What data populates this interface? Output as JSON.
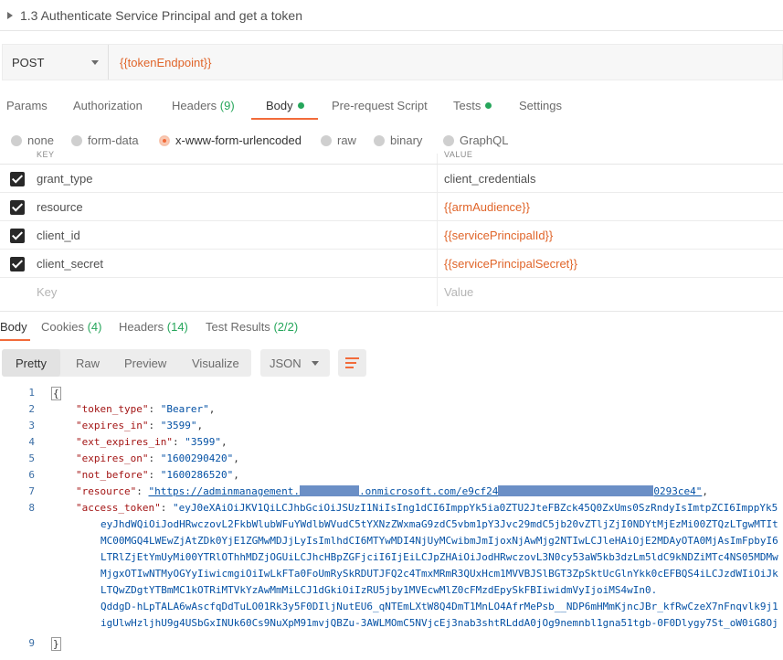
{
  "request": {
    "title": "1.3 Authenticate Service Principal and get a token",
    "method": "POST",
    "url": "{{tokenEndpoint}}"
  },
  "request_tabs": {
    "params": "Params",
    "authorization": "Authorization",
    "headers": "Headers",
    "headers_count": "(9)",
    "body": "Body",
    "prerequest": "Pre-request Script",
    "tests": "Tests",
    "settings": "Settings"
  },
  "body_modes": {
    "none": "none",
    "form_data": "form-data",
    "urlencoded": "x-www-form-urlencoded",
    "raw": "raw",
    "binary": "binary",
    "graphql": "GraphQL",
    "selected": "x-www-form-urlencoded"
  },
  "kv_table": {
    "key_header": "KEY",
    "value_header": "VALUE",
    "rows": [
      {
        "key": "grant_type",
        "value": "client_credentials",
        "checked": true
      },
      {
        "key": "resource",
        "value": "{{armAudience}}",
        "checked": true
      },
      {
        "key": "client_id",
        "value": "{{servicePrincipalId}}",
        "checked": true
      },
      {
        "key": "client_secret",
        "value": "{{servicePrincipalSecret}}",
        "checked": true
      }
    ],
    "key_placeholder": "Key",
    "value_placeholder": "Value"
  },
  "response_tabs": {
    "body": "Body",
    "cookies": "Cookies",
    "cookies_count": "(4)",
    "headers": "Headers",
    "headers_count": "(14)",
    "test_results": "Test Results",
    "test_results_count": "(2/2)"
  },
  "view_modes": {
    "pretty": "Pretty",
    "raw": "Raw",
    "preview": "Preview",
    "visualize": "Visualize",
    "format": "JSON"
  },
  "response_json": {
    "line_numbers": [
      "1",
      "2",
      "3",
      "4",
      "5",
      "6",
      "7",
      "8",
      "9"
    ],
    "open_brace": "{",
    "close_brace": "}",
    "token_type_key": "\"token_type\"",
    "token_type_val": "\"Bearer\"",
    "expires_in_key": "\"expires_in\"",
    "expires_in_val": "\"3599\"",
    "ext_expires_in_key": "\"ext_expires_in\"",
    "ext_expires_in_val": "\"3599\"",
    "expires_on_key": "\"expires_on\"",
    "expires_on_val": "\"1600290420\"",
    "not_before_key": "\"not_before\"",
    "not_before_val": "\"1600286520\"",
    "resource_key": "\"resource\"",
    "resource_val_a": "\"https://adminmanagement.",
    "resource_val_b": ".onmicrosoft.com/e9cf24",
    "resource_val_c": "0293ce4\"",
    "access_token_key": "\"access_token\"",
    "access_token_lines": [
      "\"eyJ0eXAiOiJKV1QiLCJhbGciOiJSUzI1NiIsIng1dCI6ImppYk5ia0ZTU2JteFBZck45Q0ZxUms0SzRndyIsImtpZCI6ImppYk5",
      "eyJhdWQiOiJodHRwczovL2FkbWlubWFuYWdlbWVudC5tYXNzZWxmaG9zdC5vbm1pY3Jvc29mdC5jb20vZTljZjI0NDYtMjEzMi00ZTQzLTgwMTIt",
      "MC00MGQ4LWEwZjAtZDk0YjE1ZGMwMDJjLyIsImlhdCI6MTYwMDI4NjUyMCwibmJmIjoxNjAwMjg2NTIwLCJleHAiOjE2MDAyOTA0MjAsImFpbyI6",
      "LTRlZjEtYmUyMi00YTRlOThhMDZjOGUiLCJhcHBpZGFjciI6IjEiLCJpZHAiOiJodHRwczovL3N0cy53aW5kb3dzLm5ldC9kNDZiMTc4NS05MDMw",
      "MjgxOTIwNTMyOGYyIiwicmgiOiIwLkFTa0FoUmRySkRDUTJFQ2c4TmxMRmR3QUxHcm1MVVBJSlBGT3ZpSktUcGlnYkk0cEFBQS4iLCJzdWIiOiJk",
      "LTQwZDgtYTBmMC1kOTRiMTVkYzAwMmMiLCJ1dGkiOiIzRU5jby1MVEcwMlZ0cFMzdEpySkFBIiwidmVyIjoiMS4wIn0.",
      "QddgD-hLpTALA6wAscfqDdTuLO01Rk3y5F0DIljNutEU6_qNTEmLXtW8Q4DmT1MnLO4AfrMePsb__NDP6mHMmKjncJBr_kfRwCzeX7nFnqvlk9j1",
      "igUlwHzljhU9g4USbGxINUk60Cs9NuXpM91mvjQBZu-3AWLMOmC5NVjcEj3nab3shtRLddA0jOg9nemnbl1gna51tgb-0F0Dlygy7St_oW0iG8Oj"
    ]
  },
  "colors": {
    "accent": "#f26b3a",
    "variable": "#e0652a",
    "success": "#26a65b",
    "json_key": "#a31515",
    "json_string": "#0451a5",
    "redaction": "#6b8fc6"
  }
}
